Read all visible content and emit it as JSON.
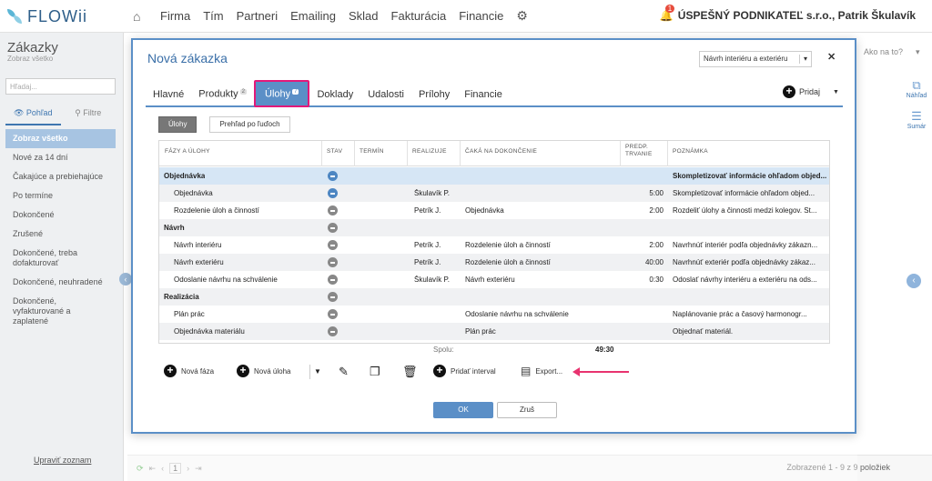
{
  "app": {
    "logo": "FLOWii",
    "nav": [
      "Firma",
      "Tím",
      "Partneri",
      "Emailing",
      "Sklad",
      "Fakturácia",
      "Financie"
    ],
    "notifications_count": "1",
    "company": "ÚSPEŠNÝ PODNIKATEĽ s.r.o., Patrik Škulavík"
  },
  "sidebar": {
    "title": "Zákazky",
    "subtitle": "Zobraz všetko",
    "search_placeholder": "Hľadaj...",
    "tabs": [
      "Pohľad",
      "Filtre"
    ],
    "items": [
      "Zobraz všetko",
      "Nové za 14 dní",
      "Čakajúce a prebiehajúce",
      "Po termíne",
      "Dokončené",
      "Zrušené",
      "Dokončené, treba dofakturovať",
      "Dokončené, neuhradené",
      "Dokončené, vyfakturované a zaplatené"
    ],
    "footer_link": "Upraviť zoznam"
  },
  "right_panel": {
    "ako": "Ako na to?",
    "tools": [
      "Náhľad",
      "Sumár"
    ]
  },
  "footer": {
    "page": "1",
    "shown": "Zobrazené 1 - 9 z 9 položiek"
  },
  "modal": {
    "title": "Nová zákazka",
    "template_select": "Návrh interiéru a exteriéru",
    "tabs": [
      {
        "label": "Hlavné",
        "badge": ""
      },
      {
        "label": "Produkty",
        "badge": "2"
      },
      {
        "label": "Úlohy",
        "badge": "7"
      },
      {
        "label": "Doklady",
        "badge": ""
      },
      {
        "label": "Udalosti",
        "badge": ""
      },
      {
        "label": "Prílohy",
        "badge": ""
      },
      {
        "label": "Financie",
        "badge": ""
      }
    ],
    "active_tab": "Úlohy",
    "add_label": "Pridaj",
    "subviews": [
      "Úlohy",
      "Prehľad po ľuďoch"
    ],
    "columns": [
      "FÁZY A ÚLOHY",
      "STAV",
      "TERMÍN",
      "REALIZUJE",
      "ČAKÁ NA DOKONČENIE",
      "PREDP. TRVANIE",
      "POZNÁMKA"
    ],
    "rows": [
      {
        "name": "Objednávka",
        "phase": true,
        "status": "blue",
        "realizuje": "",
        "caka": "",
        "trvanie": "",
        "poznamka": "Skompletizovať informácie ohľadom objed..."
      },
      {
        "name": "Objednávka",
        "phase": false,
        "status": "blue",
        "realizuje": "Škulavík P.",
        "caka": "",
        "trvanie": "5:00",
        "poznamka": "Skompletizovať informácie ohľadom objed..."
      },
      {
        "name": "Rozdelenie úloh a činností",
        "phase": false,
        "status": "gray",
        "realizuje": "Petrík J.",
        "caka": "Objednávka",
        "trvanie": "2:00",
        "poznamka": "Rozdeliť úlohy a činnosti medzi kolegov. St..."
      },
      {
        "name": "Návrh",
        "phase": true,
        "status": "gray",
        "realizuje": "",
        "caka": "",
        "trvanie": "",
        "poznamka": ""
      },
      {
        "name": "Návrh interiéru",
        "phase": false,
        "status": "gray",
        "realizuje": "Petrík J.",
        "caka": "Rozdelenie úloh a činností",
        "trvanie": "2:00",
        "poznamka": "Navrhnúť interiér podľa objednávky zákazn..."
      },
      {
        "name": "Návrh exteriéru",
        "phase": false,
        "status": "gray",
        "realizuje": "Petrík J.",
        "caka": "Rozdelenie úloh a činností",
        "trvanie": "40:00",
        "poznamka": "Navrhnúť exteriér podľa objednávky zákaz..."
      },
      {
        "name": "Odoslanie návrhu na schválenie",
        "phase": false,
        "status": "gray",
        "realizuje": "Škulavík P.",
        "caka": "Návrh exteriéru",
        "trvanie": "0:30",
        "poznamka": "Odoslať návrhy interiéru a exteriéru na ods..."
      },
      {
        "name": "Realizácia",
        "phase": true,
        "status": "gray",
        "realizuje": "",
        "caka": "",
        "trvanie": "",
        "poznamka": ""
      },
      {
        "name": "Plán prác",
        "phase": false,
        "status": "gray",
        "realizuje": "",
        "caka": "Odoslanie návrhu na schválenie",
        "trvanie": "",
        "poznamka": "Naplánovanie prác a časový harmonogr..."
      },
      {
        "name": "Objednávka materiálu",
        "phase": false,
        "status": "gray",
        "realizuje": "",
        "caka": "Plán prác",
        "trvanie": "",
        "poznamka": "Objednať materiál."
      }
    ],
    "total_label": "Spolu:",
    "total_value": "49:30",
    "actions": {
      "new_phase": "Nová fáza",
      "new_task": "Nová úloha",
      "add_interval": "Pridať interval",
      "export": "Export..."
    },
    "ok": "OK",
    "cancel": "Zruš"
  }
}
